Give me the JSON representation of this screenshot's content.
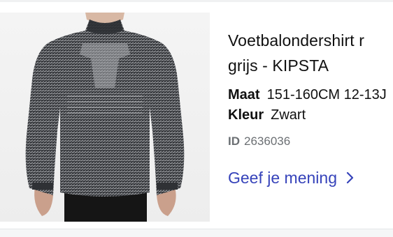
{
  "product": {
    "image_icon": "long-sleeve-shirt-photo",
    "title_line1": "Voetbalondershirt r",
    "title_line2": "grijs - KIPSTA",
    "attributes": [
      {
        "label": "Maat",
        "value": "151-160CM 12-13J"
      },
      {
        "label": "Kleur",
        "value": "Zwart"
      }
    ],
    "id_label": "ID",
    "id_value": "2636036"
  },
  "review": {
    "label": "Geef je mening",
    "icon": "chevron-right-icon",
    "color": "#3643ba"
  }
}
